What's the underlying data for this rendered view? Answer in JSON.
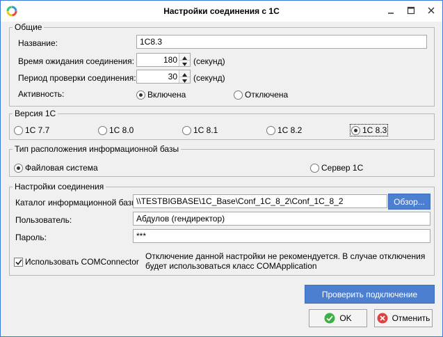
{
  "window": {
    "title": "Настройки соединения с 1С"
  },
  "general": {
    "legend": "Общие",
    "name_label": "Название:",
    "name_value": "1C8.3",
    "timeout_label": "Время ожидания соединения:",
    "timeout_value": "180",
    "timeout_unit": "(секунд)",
    "check_period_label": "Период проверки соединения:",
    "check_period_value": "30",
    "check_period_unit": "(секунд)",
    "activity_label": "Активность:",
    "activity_on": "Включена",
    "activity_off": "Отключена",
    "activity_selected": "Включена"
  },
  "version": {
    "legend": "Версия 1С",
    "options": [
      "1С 7.7",
      "1С 8.0",
      "1С 8.1",
      "1С 8.2",
      "1С 8.3"
    ],
    "selected": "1С 8.3"
  },
  "location": {
    "legend": "Тип расположения информационной базы",
    "file_label": "Файловая система",
    "server_label": "Сервер 1С",
    "selected": "Файловая система"
  },
  "connection": {
    "legend": "Настройки соединения",
    "catalog_label": "Каталог информационной базы:",
    "catalog_value": "\\\\TESTBIGBASE\\1C_Base\\Conf_1C_8_2\\Conf_1C_8_2",
    "browse_label": "Обзор...",
    "user_label": "Пользователь:",
    "user_value": "Абдулов (гендиректор)",
    "password_label": "Пароль:",
    "password_value": "***",
    "com_label": "Использовать COMConnector",
    "com_checked": true,
    "hint_line1": "Отключение данной настройки не рекомендуется. В случае отключения",
    "hint_line2": "будет использоваться класс COMApplication"
  },
  "buttons": {
    "test": "Проверить подключение",
    "ok": "OK",
    "cancel": "Отменить"
  },
  "colors": {
    "accent": "#4d7fd1",
    "window_border": "#3c78d8"
  }
}
